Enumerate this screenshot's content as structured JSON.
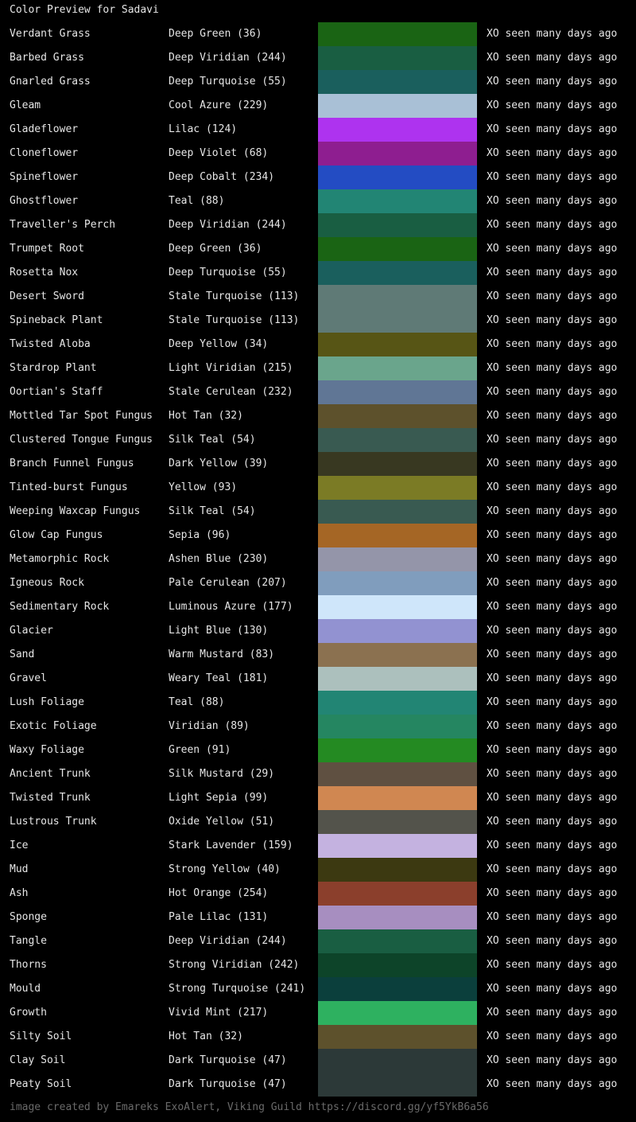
{
  "header": {
    "title": "Color Preview for Sadavi"
  },
  "rows": [
    {
      "name": "Verdant Grass",
      "color_label": "Deep Green (36)",
      "swatch": "#1a6414",
      "status": "XO seen many days ago"
    },
    {
      "name": "Barbed Grass",
      "color_label": "Deep Viridian (244)",
      "swatch": "#195e42",
      "status": "XO seen many days ago"
    },
    {
      "name": "Gnarled Grass",
      "color_label": "Deep Turquoise (55)",
      "swatch": "#1a5f5d",
      "status": "XO seen many days ago"
    },
    {
      "name": "Gleam",
      "color_label": "Cool Azure (229)",
      "swatch": "#a9c0d6",
      "status": "XO seen many days ago"
    },
    {
      "name": "Gladeflower",
      "color_label": "Lilac (124)",
      "swatch": "#ae33ef",
      "status": "XO seen many days ago"
    },
    {
      "name": "Cloneflower",
      "color_label": "Deep Violet (68)",
      "swatch": "#8e1e90",
      "status": "XO seen many days ago"
    },
    {
      "name": "Spineflower",
      "color_label": "Deep Cobalt (234)",
      "swatch": "#234cc3",
      "status": "XO seen many days ago"
    },
    {
      "name": "Ghostflower",
      "color_label": "Teal (88)",
      "swatch": "#228574",
      "status": "XO seen many days ago"
    },
    {
      "name": "Traveller's Perch",
      "color_label": "Deep Viridian (244)",
      "swatch": "#195e42",
      "status": "XO seen many days ago"
    },
    {
      "name": "Trumpet Root",
      "color_label": "Deep Green (36)",
      "swatch": "#1a6414",
      "status": "XO seen many days ago"
    },
    {
      "name": "Rosetta Nox",
      "color_label": "Deep Turquoise (55)",
      "swatch": "#1a5f5d",
      "status": "XO seen many days ago"
    },
    {
      "name": "Desert Sword",
      "color_label": "Stale Turquoise (113)",
      "swatch": "#5f7a76",
      "status": "XO seen many days ago"
    },
    {
      "name": "Spineback Plant",
      "color_label": "Stale Turquoise (113)",
      "swatch": "#5f7a76",
      "status": "XO seen many days ago"
    },
    {
      "name": "Twisted Aloba",
      "color_label": "Deep Yellow (34)",
      "swatch": "#575515",
      "status": "XO seen many days ago"
    },
    {
      "name": "Stardrop Plant",
      "color_label": "Light Viridian (215)",
      "swatch": "#6aa58c",
      "status": "XO seen many days ago"
    },
    {
      "name": "Oortian's Staff",
      "color_label": "Stale Cerulean (232)",
      "swatch": "#607695",
      "status": "XO seen many days ago"
    },
    {
      "name": "Mottled Tar Spot Fungus",
      "color_label": "Hot Tan (32)",
      "swatch": "#5d512c",
      "status": "XO seen many days ago"
    },
    {
      "name": "Clustered Tongue Fungus",
      "color_label": "Silk Teal (54)",
      "swatch": "#395a51",
      "status": "XO seen many days ago"
    },
    {
      "name": "Branch Funnel Fungus",
      "color_label": "Dark Yellow (39)",
      "swatch": "#383821",
      "status": "XO seen many days ago"
    },
    {
      "name": "Tinted-burst Fungus",
      "color_label": "Yellow (93)",
      "swatch": "#7b7b25",
      "status": "XO seen many days ago"
    },
    {
      "name": "Weeping Waxcap Fungus",
      "color_label": "Silk Teal (54)",
      "swatch": "#395a51",
      "status": "XO seen many days ago"
    },
    {
      "name": "Glow Cap Fungus",
      "color_label": "Sepia (96)",
      "swatch": "#a56625",
      "status": "XO seen many days ago"
    },
    {
      "name": "Metamorphic Rock",
      "color_label": "Ashen Blue (230)",
      "swatch": "#9495a9",
      "status": "XO seen many days ago"
    },
    {
      "name": "Igneous Rock",
      "color_label": "Pale Cerulean (207)",
      "swatch": "#809dbd",
      "status": "XO seen many days ago"
    },
    {
      "name": "Sedimentary Rock",
      "color_label": "Luminous Azure (177)",
      "swatch": "#cfe6fa",
      "status": "XO seen many days ago"
    },
    {
      "name": "Glacier",
      "color_label": "Light Blue (130)",
      "swatch": "#9292d1",
      "status": "XO seen many days ago"
    },
    {
      "name": "Sand",
      "color_label": "Warm Mustard (83)",
      "swatch": "#8b7150",
      "status": "XO seen many days ago"
    },
    {
      "name": "Gravel",
      "color_label": "Weary Teal (181)",
      "swatch": "#acc0bd",
      "status": "XO seen many days ago"
    },
    {
      "name": "Lush Foliage",
      "color_label": "Teal (88)",
      "swatch": "#228574",
      "status": "XO seen many days ago"
    },
    {
      "name": "Exotic Foliage",
      "color_label": "Viridian (89)",
      "swatch": "#258661",
      "status": "XO seen many days ago"
    },
    {
      "name": "Waxy Foliage",
      "color_label": "Green (91)",
      "swatch": "#248a22",
      "status": "XO seen many days ago"
    },
    {
      "name": "Ancient Trunk",
      "color_label": "Silk Mustard (29)",
      "swatch": "#5f5041",
      "status": "XO seen many days ago"
    },
    {
      "name": "Twisted Trunk",
      "color_label": "Light Sepia (99)",
      "swatch": "#d08751",
      "status": "XO seen many days ago"
    },
    {
      "name": "Lustrous Trunk",
      "color_label": "Oxide Yellow (51)",
      "swatch": "#53534b",
      "status": "XO seen many days ago"
    },
    {
      "name": "Ice",
      "color_label": "Stark Lavender (159)",
      "swatch": "#c4b2e0",
      "status": "XO seen many days ago"
    },
    {
      "name": "Mud",
      "color_label": "Strong Yellow (40)",
      "swatch": "#3c3911",
      "status": "XO seen many days ago"
    },
    {
      "name": "Ash",
      "color_label": "Hot Orange (254)",
      "swatch": "#8b3f2c",
      "status": "XO seen many days ago"
    },
    {
      "name": "Sponge",
      "color_label": "Pale Lilac (131)",
      "swatch": "#a78ec0",
      "status": "XO seen many days ago"
    },
    {
      "name": "Tangle",
      "color_label": "Deep Viridian (244)",
      "swatch": "#195e42",
      "status": "XO seen many days ago"
    },
    {
      "name": "Thorns",
      "color_label": "Strong Viridian (242)",
      "swatch": "#0d4429",
      "status": "XO seen many days ago"
    },
    {
      "name": "Mould",
      "color_label": "Strong Turquoise (241)",
      "swatch": "#0b3f3c",
      "status": "XO seen many days ago"
    },
    {
      "name": "Growth",
      "color_label": "Vivid Mint (217)",
      "swatch": "#2eb160",
      "status": "XO seen many days ago"
    },
    {
      "name": "Silty Soil",
      "color_label": "Hot Tan (32)",
      "swatch": "#5d512c",
      "status": "XO seen many days ago"
    },
    {
      "name": "Clay Soil",
      "color_label": "Dark Turquoise (47)",
      "swatch": "#2c3938",
      "status": "XO seen many days ago"
    },
    {
      "name": "Peaty Soil",
      "color_label": "Dark Turquoise (47)",
      "swatch": "#2c3938",
      "status": "XO seen many days ago"
    }
  ],
  "footer": {
    "text": "image created by Emareks ExoAlert, Viking Guild https://discord.gg/yf5YkB6a56"
  }
}
